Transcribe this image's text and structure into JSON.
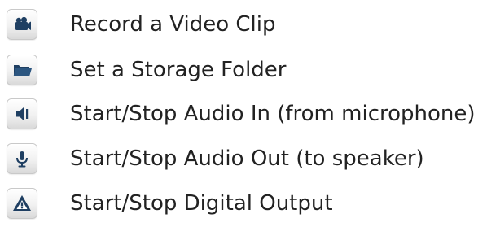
{
  "items": [
    {
      "label": "Record a Video Clip",
      "icon": "video-camera-icon"
    },
    {
      "label": "Set a Storage Folder",
      "icon": "folder-icon"
    },
    {
      "label": "Start/Stop Audio In (from microphone)",
      "icon": "speaker-icon"
    },
    {
      "label": "Start/Stop Audio Out (to speaker)",
      "icon": "microphone-icon"
    },
    {
      "label": "Start/Stop Digital Output",
      "icon": "warning-icon"
    }
  ],
  "colors": {
    "icon": "#1f3f62",
    "text": "#222222"
  }
}
